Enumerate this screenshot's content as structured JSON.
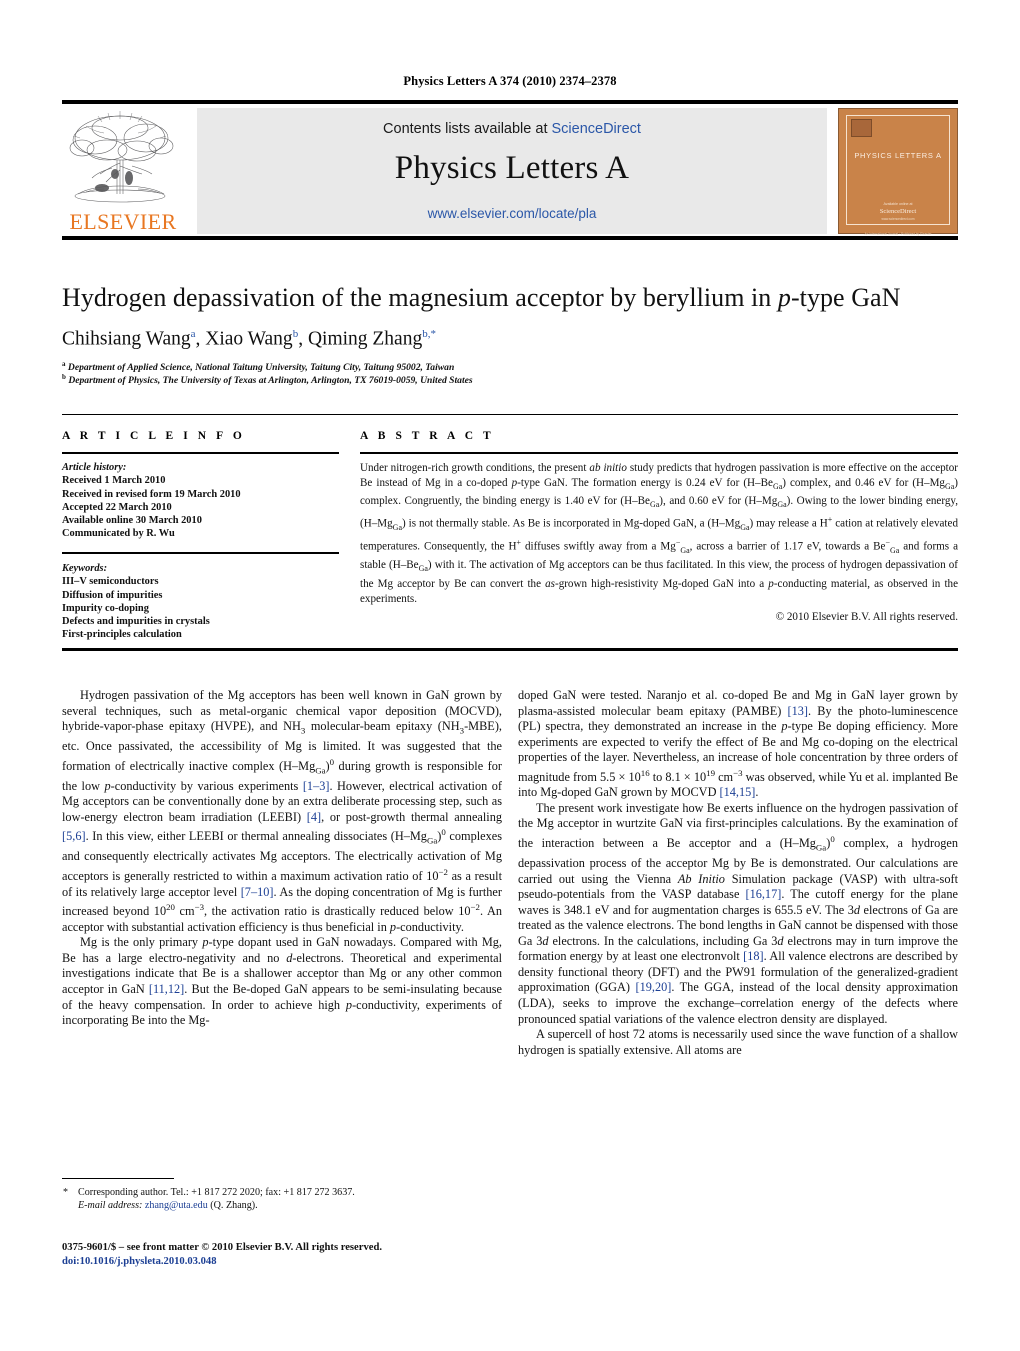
{
  "running_head": "Physics Letters A 374 (2010) 2374–2378",
  "masthead": {
    "contents_prefix": "Contents lists available at ",
    "sciencedirect": "ScienceDirect",
    "journal_title": "Physics Letters A",
    "journal_url": "www.elsevier.com/locate/pla",
    "publisher": "ELSEVIER",
    "publisher_color": "#E87722",
    "link_color": "#2b57a8",
    "cover": {
      "title": "PHYSICS LETTERS A",
      "foot1": "Available online at",
      "foot2": "ScienceDirect",
      "foot3": "www.sciencedirect.com",
      "foot4": "An International Journal · Published by Elsevier",
      "bg_color": "#c98349"
    }
  },
  "article": {
    "title_part1": "Hydrogen depassivation of the magnesium acceptor by beryllium in ",
    "title_italic": "p",
    "title_part2": "-type GaN",
    "authors": [
      {
        "name": "Chihsiang Wang",
        "marks": "a"
      },
      {
        "name": "Xiao Wang",
        "marks": "b"
      },
      {
        "name": "Qiming Zhang",
        "marks": "b,*"
      }
    ],
    "affiliations": [
      {
        "mark": "a",
        "text": "Department of Applied Science, National Taitung University, Taitung City, Taitung 95002, Taiwan"
      },
      {
        "mark": "b",
        "text": "Department of Physics, The University of Texas at Arlington, Arlington, TX 76019-0059, United States"
      }
    ]
  },
  "info": {
    "header": "A R T I C L E    I N F O",
    "history_label": "Article history:",
    "history": [
      "Received 1 March 2010",
      "Received in revised form 19 March 2010",
      "Accepted 22 March 2010",
      "Available online 30 March 2010",
      "Communicated by R. Wu"
    ],
    "keywords_label": "Keywords:",
    "keywords": [
      "III–V semiconductors",
      "Diffusion of impurities",
      "Impurity co-doping",
      "Defects and impurities in crystals",
      "First-principles calculation"
    ]
  },
  "abstract": {
    "header": "A B S T R A C T",
    "copyright": "© 2010 Elsevier B.V. All rights reserved."
  },
  "body": {
    "left_paragraphs": [
      "Hydrogen passivation of the Mg acceptors has been well known in GaN grown by several techniques, such as metal-organic chemical vapor deposition (MOCVD), hybride-vapor-phase epitaxy (HVPE), and NH3 molecular-beam epitaxy (NH3-MBE), etc. Once passivated, the accessibility of Mg is limited. It was suggested that the formation of electrically inactive complex (H–MgGa)0 during growth is responsible for the low p-conductivity by various experiments [1–3]. However, electrical activation of Mg acceptors can be conventionally done by an extra deliberate processing step, such as low-energy electron beam irradiation (LEEBI) [4], or post-growth thermal annealing [5,6]. In this view, either LEEBI or thermal annealing dissociates (H–MgGa)0 complexes and consequently electrically activates Mg acceptors. The electrically activation of Mg acceptors is generally restricted to within a maximum activation ratio of 10−2 as a result of its relatively large acceptor level [7–10]. As the doping concentration of Mg is further increased beyond 1020 cm−3, the activation ratio is drastically reduced below 10−2. An acceptor with substantial activation efficiency is thus beneficial in p-conductivity.",
      "Mg is the only primary p-type dopant used in GaN nowadays. Compared with Mg, Be has a large electro-negativity and no d-electrons. Theoretical and experimental investigations indicate that Be is a shallower acceptor than Mg or any other common acceptor in GaN [11,12]. But the Be-doped GaN appears to be semi-insulating because of the heavy compensation. In order to achieve high p-conductivity, experiments of incorporating Be into the Mg-"
    ],
    "right_paragraphs": [
      "doped GaN were tested. Naranjo et al. co-doped Be and Mg in GaN layer grown by plasma-assisted molecular beam epitaxy (PAMBE) [13]. By the photo-luminescence (PL) spectra, they demonstrated an increase in the p-type Be doping efficiency. More experiments are expected to verify the effect of Be and Mg co-doping on the electrical properties of the layer. Nevertheless, an increase of hole concentration by three orders of magnitude from 5.5 × 1016 to 8.1 × 1019 cm−3 was observed, while Yu et al. implanted Be into Mg-doped GaN grown by MOCVD [14,15].",
      "The present work investigate how Be exerts influence on the hydrogen passivation of the Mg acceptor in wurtzite GaN via first-principles calculations. By the examination of the interaction between a Be acceptor and a (H–MgGa)0 complex, a hydrogen depassivation process of the acceptor Mg by Be is demonstrated. Our calculations are carried out using the Vienna Ab Initio Simulation package (VASP) with ultra-soft pseudo-potentials from the VASP database [16,17]. The cutoff energy for the plane waves is 348.1 eV and for augmentation charges is 655.5 eV. The 3d electrons of Ga are treated as the valence electrons. The bond lengths in GaN cannot be dispensed with those Ga 3d electrons. In the calculations, including Ga 3d electrons may in turn improve the formation energy by at least one electronvolt [18]. All valence electrons are described by density functional theory (DFT) and the PW91 formulation of the generalized-gradient approximation (GGA) [19,20]. The GGA, instead of the local density approximation (LDA), seeks to improve the exchange–correlation energy of the defects where pronounced spatial variations of the valence electron density are displayed.",
      "A supercell of host 72 atoms is necessarily used since the wave function of a shallow hydrogen is spatially extensive. All atoms are"
    ]
  },
  "footnote": {
    "star": "*",
    "corresponding": "Corresponding author. Tel.: +1 817 272 2020; fax: +1 817 272 3637.",
    "email_label": "E-mail address:",
    "email": "zhang@uta.edu",
    "email_owner": "(Q. Zhang)."
  },
  "imprint": {
    "line1": "0375-9601/$ – see front matter © 2010 Elsevier B.V. All rights reserved.",
    "doi": "doi:10.1016/j.physleta.2010.03.048"
  }
}
